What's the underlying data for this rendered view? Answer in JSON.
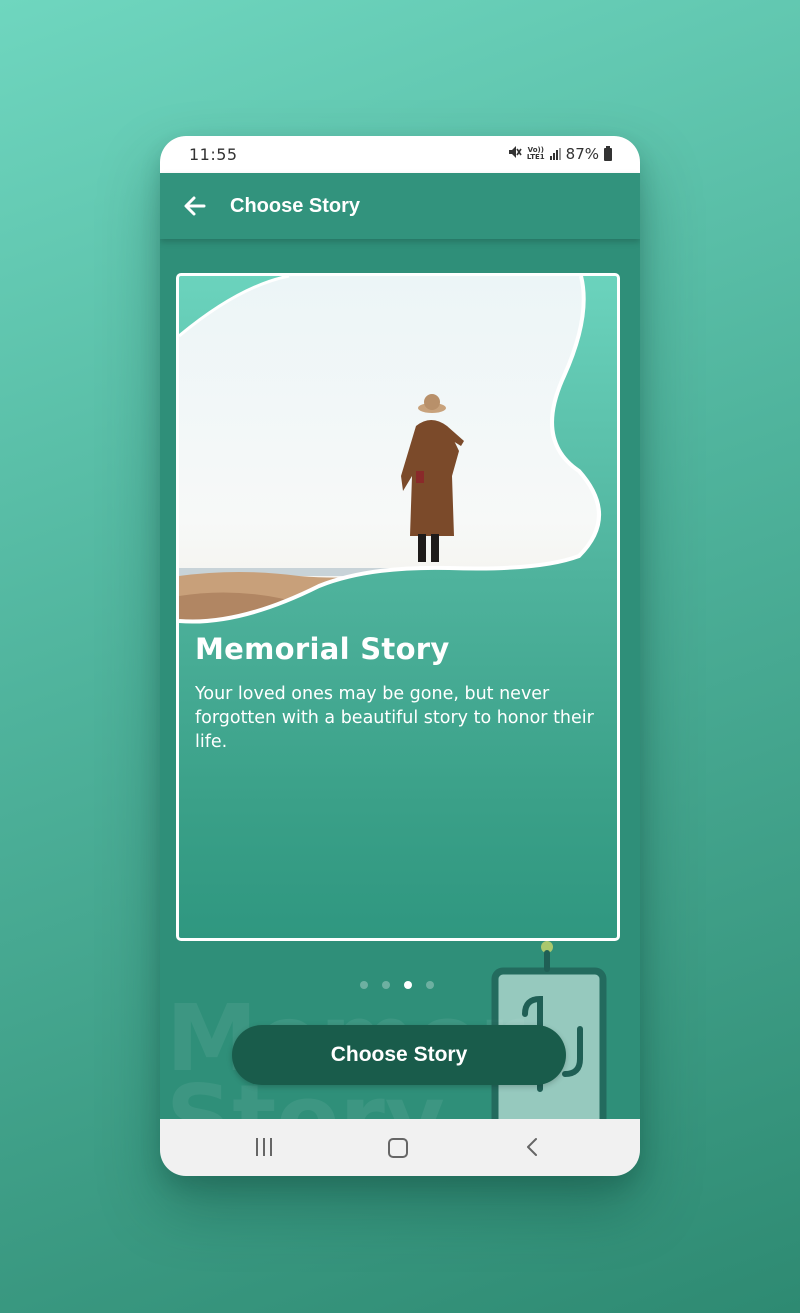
{
  "status_bar": {
    "time": "11:55",
    "lte_label_top": "Vo))",
    "lte_label_bottom": "LTE1",
    "battery": "87%"
  },
  "app_bar": {
    "title": "Choose Story",
    "back_icon": "arrow-left-icon"
  },
  "card": {
    "title": "Memorial Story",
    "description": "Your loved ones may be gone, but never forgotten with a beautiful story to honor their life."
  },
  "background_watermark": {
    "line1": "Memor",
    "line2": "Story"
  },
  "pager": {
    "count": 4,
    "active_index": 2
  },
  "button": {
    "label": "Choose Story"
  },
  "colors": {
    "primary": "#32937d",
    "button": "#195c4b",
    "card_gradient_top": "#6bd3bd"
  }
}
